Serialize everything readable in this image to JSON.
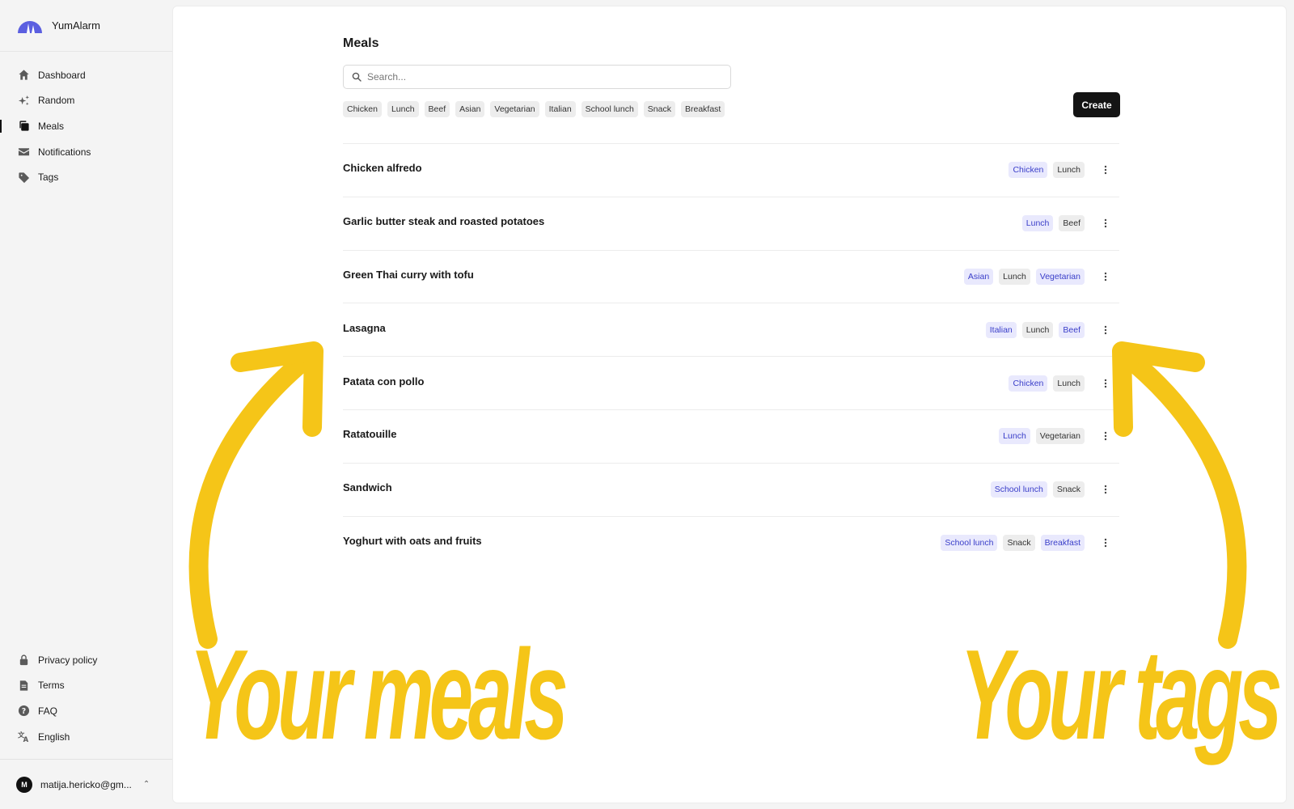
{
  "app": {
    "name": "YumAlarm"
  },
  "sidebar": {
    "items": [
      {
        "label": "Dashboard",
        "icon": "home-icon"
      },
      {
        "label": "Random",
        "icon": "sparkles-icon"
      },
      {
        "label": "Meals",
        "icon": "copy-icon",
        "active": true
      },
      {
        "label": "Notifications",
        "icon": "mail-icon"
      },
      {
        "label": "Tags",
        "icon": "tag-icon"
      }
    ],
    "bottom_items": [
      {
        "label": "Privacy policy",
        "icon": "lock-icon"
      },
      {
        "label": "Terms",
        "icon": "document-icon"
      },
      {
        "label": "FAQ",
        "icon": "help-icon"
      },
      {
        "label": "English",
        "icon": "translate-icon"
      }
    ],
    "user": {
      "avatar_letter": "M",
      "email": "matija.hericko@gm..."
    }
  },
  "main": {
    "title": "Meals",
    "search": {
      "placeholder": "Search...",
      "value": ""
    },
    "filter_tags": [
      "Chicken",
      "Lunch",
      "Beef",
      "Asian",
      "Vegetarian",
      "Italian",
      "School lunch",
      "Snack",
      "Breakfast"
    ],
    "create_label": "Create",
    "meals": [
      {
        "name": "Chicken alfredo",
        "tags": [
          {
            "label": "Chicken",
            "style": "blue"
          },
          {
            "label": "Lunch",
            "style": "gray"
          }
        ]
      },
      {
        "name": "Garlic butter steak and roasted potatoes",
        "tags": [
          {
            "label": "Lunch",
            "style": "blue"
          },
          {
            "label": "Beef",
            "style": "gray"
          }
        ]
      },
      {
        "name": "Green Thai curry with tofu",
        "tags": [
          {
            "label": "Asian",
            "style": "blue"
          },
          {
            "label": "Lunch",
            "style": "gray"
          },
          {
            "label": "Vegetarian",
            "style": "blue"
          }
        ]
      },
      {
        "name": "Lasagna",
        "tags": [
          {
            "label": "Italian",
            "style": "blue"
          },
          {
            "label": "Lunch",
            "style": "gray"
          },
          {
            "label": "Beef",
            "style": "blue"
          }
        ]
      },
      {
        "name": "Patata con pollo",
        "tags": [
          {
            "label": "Chicken",
            "style": "blue"
          },
          {
            "label": "Lunch",
            "style": "gray"
          }
        ]
      },
      {
        "name": "Ratatouille",
        "tags": [
          {
            "label": "Lunch",
            "style": "blue"
          },
          {
            "label": "Vegetarian",
            "style": "gray"
          }
        ]
      },
      {
        "name": "Sandwich",
        "tags": [
          {
            "label": "School lunch",
            "style": "blue"
          },
          {
            "label": "Snack",
            "style": "gray"
          }
        ]
      },
      {
        "name": "Yoghurt with oats and fruits",
        "tags": [
          {
            "label": "School lunch",
            "style": "blue"
          },
          {
            "label": "Snack",
            "style": "gray"
          },
          {
            "label": "Breakfast",
            "style": "blue"
          }
        ]
      }
    ]
  },
  "annotations": {
    "left_caption": "Your meals",
    "right_caption": "Your tags",
    "color": "#f5c518"
  },
  "colors": {
    "accent_tag_bg": "#e9e9fd",
    "accent_tag_text": "#3a3ec9",
    "neutral_tag_bg": "#ededed",
    "create_button": "#141414",
    "brand_logo": "#5b5fe0"
  }
}
